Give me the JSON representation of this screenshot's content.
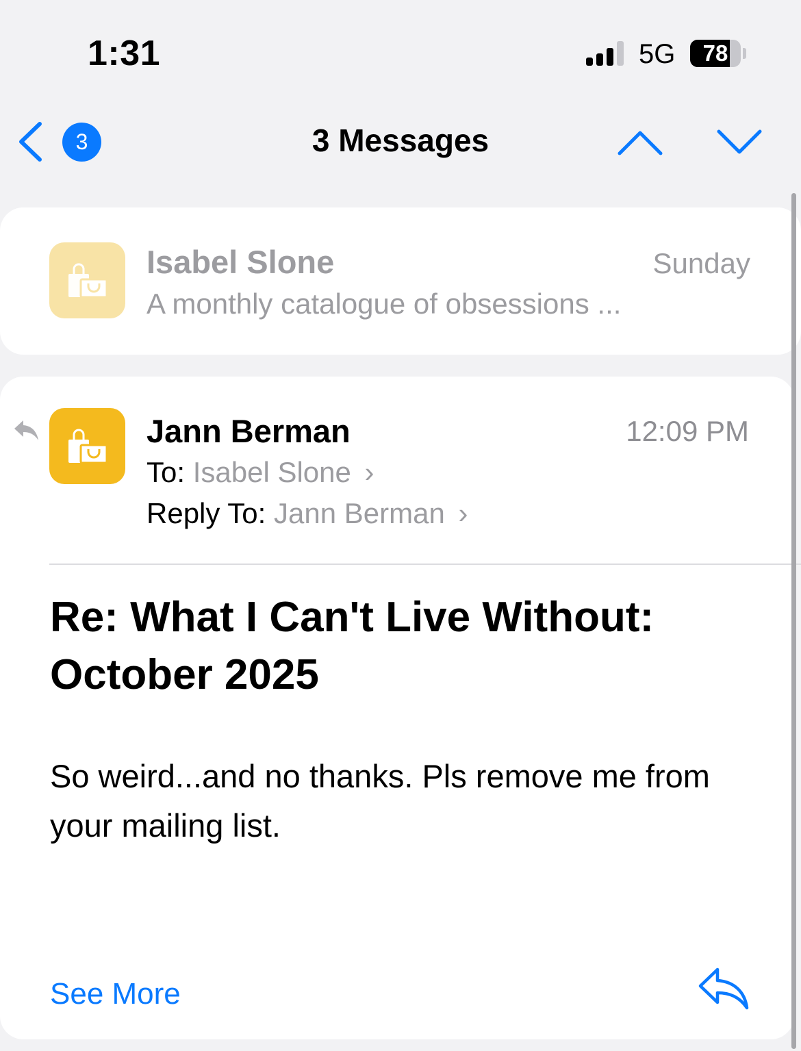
{
  "status_bar": {
    "time": "1:31",
    "network": "5G",
    "battery_level": "78",
    "battery_fraction": 0.78,
    "signal_bars_filled": 3,
    "signal_bars_total": 4
  },
  "nav": {
    "unread_badge": "3",
    "title": "3 Messages",
    "accent_color": "#0a7aff"
  },
  "thread": [
    {
      "sender": "Isabel Slone",
      "date": "Sunday",
      "preview": "A monthly catalogue of obsessions ...",
      "icon": "shopping-bags-icon",
      "icon_color": "#f8e3a6"
    },
    {
      "sender": "Jann Berman",
      "time": "12:09 PM",
      "to_label": "To:",
      "to_value": "Isabel Slone",
      "reply_to_label": "Reply To:",
      "reply_to_value": "Jann Berman",
      "subject": "Re: What I Can't Live Without: October 2025",
      "body": "So weird...and no thanks.  Pls remove me from your mailing list.",
      "see_more": "See More",
      "icon": "shopping-bags-icon",
      "icon_color": "#f4ba1e",
      "replied_indicator": "reply-arrow-icon"
    }
  ]
}
